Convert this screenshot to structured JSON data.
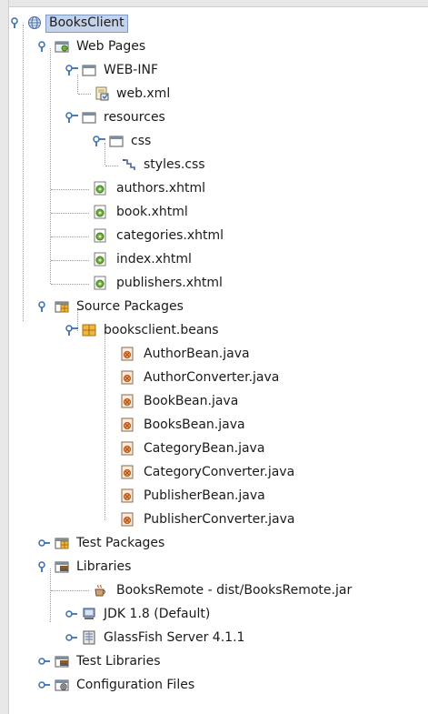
{
  "tree": {
    "project": {
      "label": "BooksClient",
      "icon": "globe-project-icon"
    },
    "web_pages": {
      "label": "Web Pages",
      "web_inf": {
        "label": "WEB-INF",
        "files": [
          {
            "label": "web.xml"
          }
        ]
      },
      "resources": {
        "label": "resources",
        "css": {
          "label": "css",
          "files": [
            {
              "label": "styles.css"
            }
          ]
        }
      },
      "files": [
        {
          "label": "authors.xhtml"
        },
        {
          "label": "book.xhtml"
        },
        {
          "label": "categories.xhtml"
        },
        {
          "label": "index.xhtml"
        },
        {
          "label": "publishers.xhtml"
        }
      ]
    },
    "source_packages": {
      "label": "Source Packages",
      "package": {
        "label": "booksclient.beans",
        "files": [
          {
            "label": "AuthorBean.java"
          },
          {
            "label": "AuthorConverter.java"
          },
          {
            "label": "BookBean.java"
          },
          {
            "label": "BooksBean.java"
          },
          {
            "label": "CategoryBean.java"
          },
          {
            "label": "CategoryConverter.java"
          },
          {
            "label": "PublisherBean.java"
          },
          {
            "label": "PublisherConverter.java"
          }
        ]
      }
    },
    "test_packages": {
      "label": "Test Packages"
    },
    "libraries": {
      "label": "Libraries",
      "items": [
        {
          "label": "BooksRemote - dist/BooksRemote.jar"
        },
        {
          "label": "JDK 1.8 (Default)"
        },
        {
          "label": "GlassFish Server 4.1.1"
        }
      ]
    },
    "test_libraries": {
      "label": "Test Libraries"
    },
    "configuration_files": {
      "label": "Configuration Files"
    }
  }
}
